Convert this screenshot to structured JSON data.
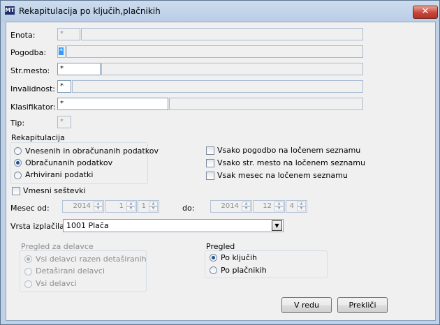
{
  "window": {
    "title": "Rekapitulacija po ključih,plačnikih",
    "close_glyph": "✕",
    "app_icon_text": "MT"
  },
  "fields": {
    "enota": {
      "label": "Enota:",
      "value": "*"
    },
    "pogodba": {
      "label": "Pogodba:",
      "value": "*"
    },
    "strmesto": {
      "label": "Str.mesto:",
      "value": "*"
    },
    "invalidnost": {
      "label": "Invalidnost:",
      "value": "*"
    },
    "klasifikator": {
      "label": "Klasifikator:",
      "value": "*"
    },
    "tip": {
      "label": "Tip:",
      "value": "*"
    }
  },
  "rekapitulacija": {
    "title": "Rekapitulacija",
    "options": [
      {
        "label": "Vnesenih in obračunanih podatkov",
        "selected": false
      },
      {
        "label": "Obračunanih podatkov",
        "selected": true
      },
      {
        "label": "Arhivirani podatki",
        "selected": false
      }
    ]
  },
  "checkboxes": {
    "pogodba": "Vsako pogodbo na ločenem seznamu",
    "strmesto": "Vsako str. mesto na ločenem seznamu",
    "mesec": "Vsak mesec na ločenem seznamu",
    "vmesni": "Vmesni seštevki"
  },
  "period": {
    "from_label": "Mesec od:",
    "to_label": "do:",
    "from": {
      "year": "2014",
      "month": "1",
      "day": "1"
    },
    "to": {
      "year": "2014",
      "month": "12",
      "day": "4"
    }
  },
  "vrsta": {
    "label": "Vrsta izplačila:",
    "value": "1001  Plača"
  },
  "delavci": {
    "title": "Pregled za delavce",
    "options": [
      {
        "label": "Vsi delavci razen detaširanih",
        "selected": true
      },
      {
        "label": "Detaširani delavci",
        "selected": false
      },
      {
        "label": "Vsi delavci",
        "selected": false
      }
    ]
  },
  "pregled": {
    "title": "Pregled",
    "options": [
      {
        "label": "Po ključih",
        "selected": true
      },
      {
        "label": "Po plačnikih",
        "selected": false
      }
    ]
  },
  "buttons": {
    "ok": "V redu",
    "cancel": "Prekliči"
  }
}
